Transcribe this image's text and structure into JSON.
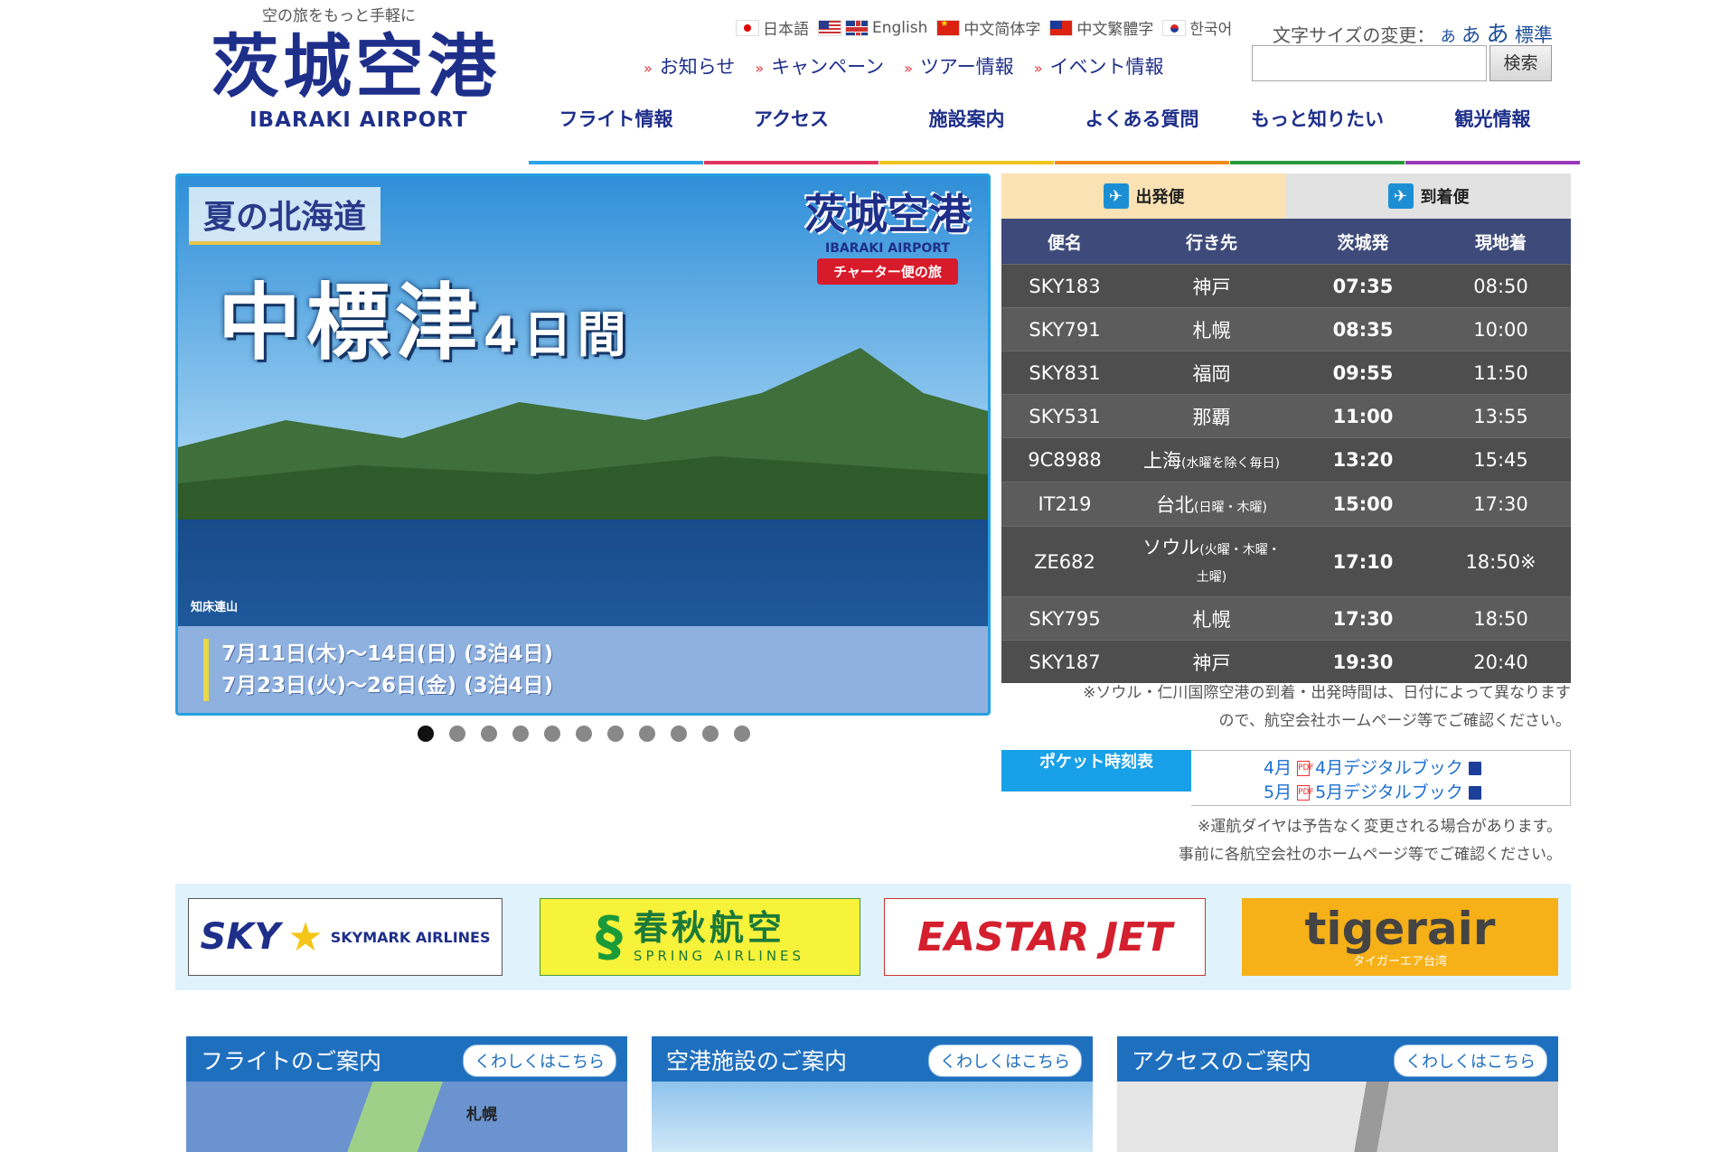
{
  "header": {
    "tagline": "空の旅をもっと手軽に",
    "logo_jp": "茨城空港",
    "logo_en": "IBARAKI AIRPORT",
    "languages": [
      "日本語",
      "English",
      "中文简体字",
      "中文繁體字",
      "한국어"
    ],
    "fontsize_label": "文字サイズの変更：",
    "fontsize_small": "あ",
    "fontsize_medium": "あ",
    "fontsize_large": "あ",
    "fontsize_standard": "標準",
    "sublinks": [
      "お知らせ",
      "キャンペーン",
      "ツアー情報",
      "イベント情報"
    ],
    "search_button": "検索",
    "search_value": "",
    "nav": [
      {
        "label": "フライト情報",
        "color": "#2aa3e8"
      },
      {
        "label": "アクセス",
        "color": "#e0345e"
      },
      {
        "label": "施設案内",
        "color": "#f0c41a"
      },
      {
        "label": "よくある質問",
        "color": "#f08a1a"
      },
      {
        "label": "もっと知りたい",
        "color": "#2a9a3a"
      },
      {
        "label": "観光情報",
        "color": "#9a3ab8"
      }
    ]
  },
  "hero": {
    "subtitle": "夏の北海道",
    "title": "中標津",
    "title_suffix": "4日間",
    "brand_jp": "茨城空港",
    "brand_en": "IBARAKI AIRPORT",
    "ribbon": "チャーター便の旅",
    "caption": "知床連山",
    "dates": [
      "7月11日(木)～14日(日) (3泊4日)",
      "7月23日(火)～26日(金) (3泊4日)"
    ],
    "slide_count": 11,
    "active_slide": 0
  },
  "board": {
    "tab_departures": "出発便",
    "tab_arrivals": "到着便",
    "columns": [
      "便名",
      "行き先",
      "茨城発",
      "現地着"
    ],
    "rows": [
      {
        "flight": "SKY183",
        "dest": "神戸",
        "dest_note": "",
        "dep": "07:35",
        "arr": "08:50"
      },
      {
        "flight": "SKY791",
        "dest": "札幌",
        "dest_note": "",
        "dep": "08:35",
        "arr": "10:00"
      },
      {
        "flight": "SKY831",
        "dest": "福岡",
        "dest_note": "",
        "dep": "09:55",
        "arr": "11:50"
      },
      {
        "flight": "SKY531",
        "dest": "那覇",
        "dest_note": "",
        "dep": "11:00",
        "arr": "13:55"
      },
      {
        "flight": "9C8988",
        "dest": "上海",
        "dest_note": "(水曜を除く毎日)",
        "dep": "13:20",
        "arr": "15:45"
      },
      {
        "flight": "IT219",
        "dest": "台北",
        "dest_note": "(日曜・木曜)",
        "dep": "15:00",
        "arr": "17:30"
      },
      {
        "flight": "ZE682",
        "dest": "ソウル",
        "dest_note": "(火曜・木曜・土曜)",
        "dep": "17:10",
        "arr": "18:50※"
      },
      {
        "flight": "SKY795",
        "dest": "札幌",
        "dest_note": "",
        "dep": "17:30",
        "arr": "18:50"
      },
      {
        "flight": "SKY187",
        "dest": "神戸",
        "dest_note": "",
        "dep": "19:30",
        "arr": "20:40"
      }
    ],
    "note_line1": "※ソウル・仁川国際空港の到着・出発時間は、日付によって異なります",
    "note_line2": "ので、航空会社ホームページ等でご確認ください。"
  },
  "pocket": {
    "label": "ポケット時刻表",
    "items": [
      {
        "month": "4月",
        "book": "4月デジタルブック"
      },
      {
        "month": "5月",
        "book": "5月デジタルブック"
      }
    ],
    "note_line1": "※運航ダイヤは予告なく変更される場合があります。",
    "note_line2": "事前に各航空会社のホームページ等でご確認ください。"
  },
  "airlines": {
    "skymark_big": "SKY",
    "skymark_small": "SKYMARK AIRLINES",
    "spring_jp": "春秋航空",
    "spring_en": "SPRING AIRLINES",
    "eastar": "EASTAR JET",
    "tiger": "tigerair",
    "tiger_sub": "タイガーエア台湾"
  },
  "cards": [
    {
      "title": "フライトのご案内",
      "more": "くわしくはこちら",
      "map_label": "札幌"
    },
    {
      "title": "空港施設のご案内",
      "more": "くわしくはこちら"
    },
    {
      "title": "アクセスのご案内",
      "more": "くわしくはこちら"
    }
  ]
}
